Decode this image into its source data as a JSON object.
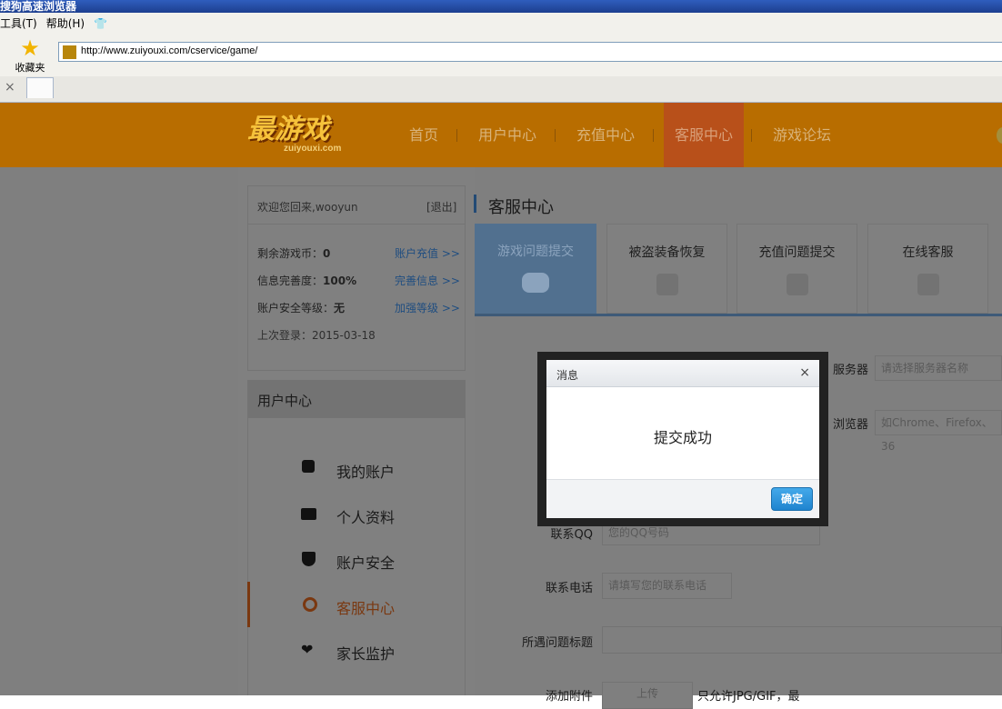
{
  "browser": {
    "title": "搜狗高速浏览器",
    "menu": [
      "工具(T)",
      "帮助(H)"
    ],
    "favorites_label": "收藏夹",
    "url": "http://www.zuiyouxi.com/cservice/game/",
    "close_tab": "×"
  },
  "site": {
    "logo_text": "最游戏",
    "logo_domain": "zuiyouxi.com",
    "nav": [
      "首页",
      "用户中心",
      "充值中心",
      "客服中心",
      "游戏论坛"
    ]
  },
  "account": {
    "welcome": "欢迎您回来,wooyun",
    "logout": "[退出]",
    "coins_label": "剩余游戏币：",
    "coins_value": "0",
    "coins_link": "账户充值 >>",
    "profile_label": "信息完善度：",
    "profile_value": "100%",
    "profile_link": "完善信息 >>",
    "security_label": "账户安全等级：",
    "security_value": "无",
    "security_link": "加强等级 >>",
    "last_login": "上次登录：2015-03-18"
  },
  "usercenter": {
    "title": "用户中心",
    "items": [
      "我的账户",
      "个人资料",
      "账户安全",
      "客服中心",
      "家长监护"
    ]
  },
  "service": {
    "title": "客服中心",
    "tabs": [
      "游戏问题提交",
      "被盗装备恢复",
      "充值问题提交",
      "在线客服"
    ]
  },
  "form": {
    "server_label": "服务器",
    "server_placeholder": "请选择服务器名称",
    "browser_label": "浏览器",
    "browser_placeholder": "如Chrome、Firefox、36",
    "qq_label": "联系QQ",
    "qq_placeholder": "您的QQ号码",
    "phone_label": "联系电话",
    "phone_placeholder": "请填写您的联系电话",
    "title_label": "所遇问题标题",
    "attach_label": "添加附件",
    "upload_button": "上传",
    "attach_note": "只允许JPG/GIF，最"
  },
  "dialog": {
    "title": "消息",
    "close": "×",
    "message": "提交成功",
    "ok": "确定"
  }
}
